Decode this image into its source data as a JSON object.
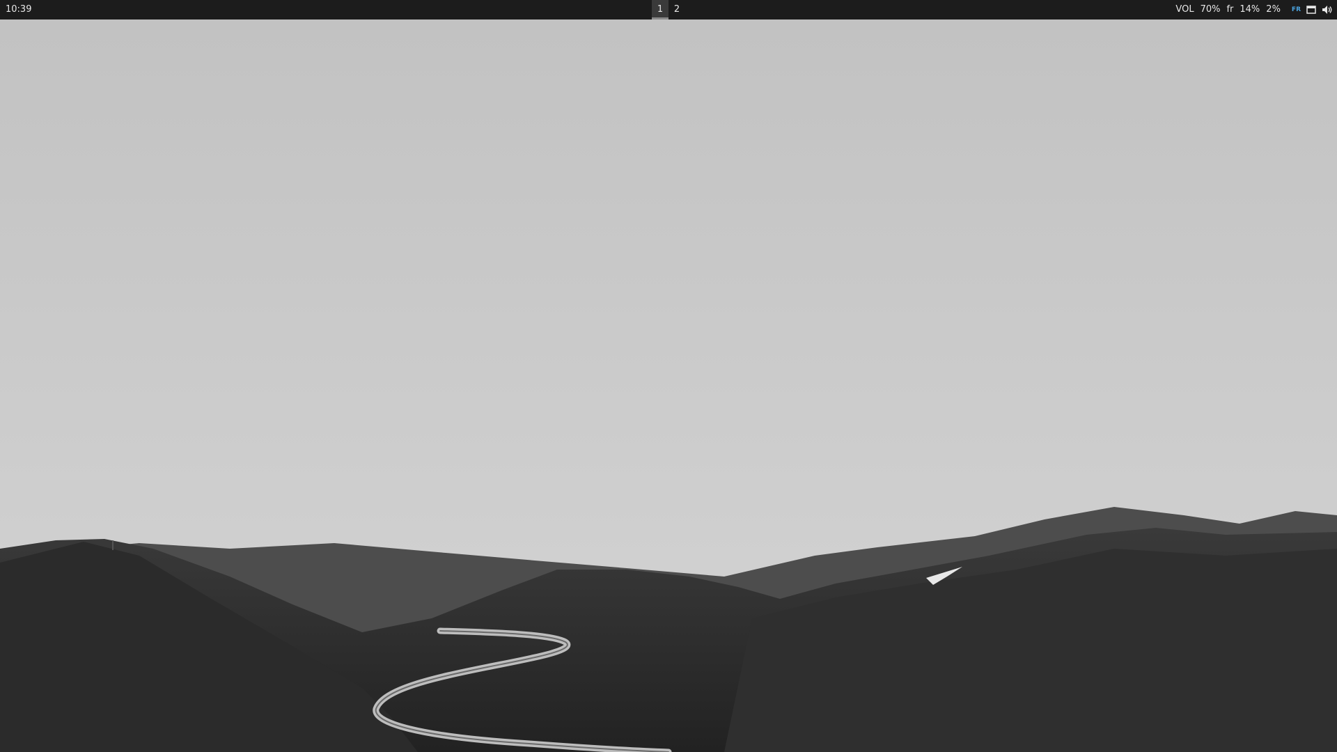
{
  "topbar": {
    "clock": "10:39",
    "workspaces": [
      {
        "label": "1",
        "active": true
      },
      {
        "label": "2",
        "active": false
      }
    ],
    "status": {
      "vol_label": "VOL",
      "vol_value": "70%",
      "layout": "fr",
      "cpu": "14%",
      "mem": "2%",
      "lang_badge": "FR"
    },
    "tray_icons": [
      "window-icon",
      "speaker-icon"
    ]
  },
  "colors": {
    "bar_bg": "#1c1c1c",
    "bar_text": "#e8e8e8",
    "lang_badge": "#4aa3df",
    "active_workspace_bg": "#3a3a3a"
  },
  "wallpaper": {
    "style": "monochrome landscape"
  }
}
